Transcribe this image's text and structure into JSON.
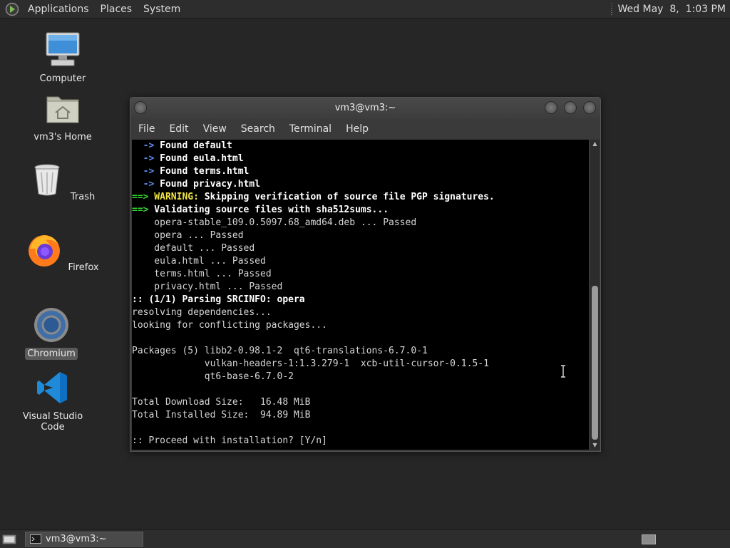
{
  "top_panel": {
    "menus": [
      "Applications",
      "Places",
      "System"
    ],
    "clock": "Wed May  8,  1:03 PM"
  },
  "desktop": {
    "icons": [
      {
        "label": "Computer",
        "icon": "computer-icon"
      },
      {
        "label": "vm3's Home",
        "icon": "home-folder-icon"
      },
      {
        "label": "Trash",
        "icon": "trash-icon"
      },
      {
        "label": "Firefox",
        "icon": "firefox-icon"
      },
      {
        "label": "Chromium",
        "icon": "chromium-icon",
        "selected": true
      },
      {
        "label": "Visual Studio Code",
        "icon": "vscode-icon"
      }
    ]
  },
  "terminal": {
    "title": "vm3@vm3:~",
    "menu": [
      "File",
      "Edit",
      "View",
      "Search",
      "Terminal",
      "Help"
    ],
    "lines": [
      [
        {
          "t": "  ",
          "c": ""
        },
        {
          "t": "->",
          "c": "bl"
        },
        {
          "t": " Found default",
          "c": "b"
        }
      ],
      [
        {
          "t": "  ",
          "c": ""
        },
        {
          "t": "->",
          "c": "bl"
        },
        {
          "t": " Found eula.html",
          "c": "b"
        }
      ],
      [
        {
          "t": "  ",
          "c": ""
        },
        {
          "t": "->",
          "c": "bl"
        },
        {
          "t": " Found terms.html",
          "c": "b"
        }
      ],
      [
        {
          "t": "  ",
          "c": ""
        },
        {
          "t": "->",
          "c": "bl"
        },
        {
          "t": " Found privacy.html",
          "c": "b"
        }
      ],
      [
        {
          "t": "==>",
          "c": "g"
        },
        {
          "t": " WARNING:",
          "c": "y"
        },
        {
          "t": " Skipping verification of source file PGP signatures.",
          "c": "b"
        }
      ],
      [
        {
          "t": "==>",
          "c": "g"
        },
        {
          "t": " Validating source files with sha512sums...",
          "c": "b"
        }
      ],
      [
        {
          "t": "    opera-stable_109.0.5097.68_amd64.deb ... Passed",
          "c": ""
        }
      ],
      [
        {
          "t": "    opera ... Passed",
          "c": ""
        }
      ],
      [
        {
          "t": "    default ... Passed",
          "c": ""
        }
      ],
      [
        {
          "t": "    eula.html ... Passed",
          "c": ""
        }
      ],
      [
        {
          "t": "    terms.html ... Passed",
          "c": ""
        }
      ],
      [
        {
          "t": "    privacy.html ... Passed",
          "c": ""
        }
      ],
      [
        {
          "t": ":: (1/1) Parsing SRCINFO: opera",
          "c": "b"
        }
      ],
      [
        {
          "t": "resolving dependencies...",
          "c": ""
        }
      ],
      [
        {
          "t": "looking for conflicting packages...",
          "c": ""
        }
      ],
      [
        {
          "t": "",
          "c": ""
        }
      ],
      [
        {
          "t": "Packages (5) libb2-0.98.1-2  qt6-translations-6.7.0-1",
          "c": ""
        }
      ],
      [
        {
          "t": "             vulkan-headers-1:1.3.279-1  xcb-util-cursor-0.1.5-1",
          "c": ""
        }
      ],
      [
        {
          "t": "             qt6-base-6.7.0-2",
          "c": ""
        }
      ],
      [
        {
          "t": "",
          "c": ""
        }
      ],
      [
        {
          "t": "Total Download Size:   16.48 MiB",
          "c": ""
        }
      ],
      [
        {
          "t": "Total Installed Size:  94.89 MiB",
          "c": ""
        }
      ],
      [
        {
          "t": "",
          "c": ""
        }
      ],
      [
        {
          "t": ":: Proceed with installation? [Y/n]",
          "c": ""
        }
      ]
    ]
  },
  "taskbar": {
    "task_label": "vm3@vm3:~"
  },
  "colors": {
    "desktop_bg": "#262626",
    "panel_bg": "#2d2d2d",
    "terminal_bg": "#000000",
    "prompt_green": "#33d633",
    "arrow_blue": "#5c8df2",
    "warning_yellow": "#f2e646"
  }
}
